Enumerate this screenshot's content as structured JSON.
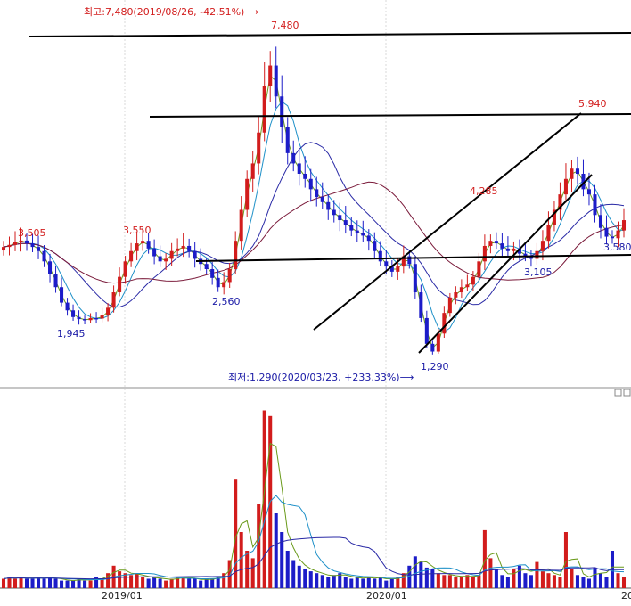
{
  "chart_data": {
    "type": "candlestick",
    "x_axis_labels": [
      "2019/01",
      "2020/01",
      "20"
    ],
    "high": {
      "text": "최고:7,480(2019/08/26, -42.51%)⟶",
      "value": 7480,
      "date": "2019/08/26",
      "change": "-42.51%"
    },
    "low": {
      "text": "최저:1,290(2020/03/23, +233.33%)⟶",
      "value": 1290,
      "date": "2020/03/23",
      "change": "+233.33%"
    },
    "price_labels": [
      {
        "text": "7,480",
        "value": 7480,
        "color": "#d21c1c"
      },
      {
        "text": "5,940",
        "value": 5940,
        "color": "#d21c1c"
      },
      {
        "text": "4,285",
        "value": 4285,
        "color": "#d21c1c"
      },
      {
        "text": "3,550",
        "value": 3550,
        "color": "#d21c1c"
      },
      {
        "text": "3,505",
        "value": 3505,
        "color": "#d21c1c"
      },
      {
        "text": "3,580",
        "value": 3580,
        "color": "#1a1aa6"
      },
      {
        "text": "3,105",
        "value": 3105,
        "color": "#1a1aa6"
      },
      {
        "text": "2,560",
        "value": 2560,
        "color": "#1a1aa6"
      },
      {
        "text": "1,945",
        "value": 1945,
        "color": "#1a1aa6"
      },
      {
        "text": "1,290",
        "value": 1290,
        "color": "#1a1aa6"
      }
    ],
    "weekly_close": [
      3380,
      3420,
      3480,
      3505,
      3450,
      3380,
      3300,
      3100,
      2850,
      2600,
      2300,
      2150,
      2020,
      1980,
      1960,
      2000,
      1990,
      2050,
      2200,
      2500,
      2800,
      3100,
      3300,
      3450,
      3500,
      3350,
      3200,
      3100,
      3150,
      3300,
      3350,
      3400,
      3300,
      3150,
      3050,
      2950,
      2780,
      2600,
      2700,
      2950,
      3500,
      4100,
      4700,
      5000,
      5600,
      6500,
      6900,
      6300,
      5700,
      5200,
      5000,
      4800,
      4700,
      4500,
      4350,
      4250,
      4100,
      4000,
      3900,
      3800,
      3700,
      3650,
      3600,
      3500,
      3300,
      3100,
      3000,
      2900,
      3000,
      3200,
      3050,
      2500,
      2000,
      1500,
      1350,
      1700,
      2100,
      2400,
      2500,
      2600,
      2650,
      2800,
      3100,
      3400,
      3500,
      3450,
      3350,
      3300,
      3350,
      3250,
      3200,
      3150,
      3300,
      3500,
      3800,
      4100,
      4400,
      4700,
      4900,
      4800,
      4500,
      4400,
      4000,
      3750,
      3580,
      3550,
      3700,
      3900
    ],
    "weekly_volume_relative": [
      0.05,
      0.06,
      0.05,
      0.06,
      0.05,
      0.05,
      0.06,
      0.05,
      0.06,
      0.05,
      0.04,
      0.04,
      0.04,
      0.05,
      0.04,
      0.04,
      0.06,
      0.05,
      0.08,
      0.12,
      0.09,
      0.08,
      0.07,
      0.08,
      0.06,
      0.05,
      0.06,
      0.05,
      0.04,
      0.05,
      0.06,
      0.06,
      0.05,
      0.05,
      0.04,
      0.05,
      0.05,
      0.06,
      0.08,
      0.15,
      0.58,
      0.3,
      0.2,
      0.16,
      0.45,
      0.95,
      0.92,
      0.4,
      0.3,
      0.2,
      0.15,
      0.12,
      0.1,
      0.09,
      0.08,
      0.07,
      0.06,
      0.07,
      0.08,
      0.06,
      0.05,
      0.06,
      0.05,
      0.06,
      0.05,
      0.06,
      0.04,
      0.05,
      0.06,
      0.08,
      0.12,
      0.17,
      0.14,
      0.11,
      0.1,
      0.08,
      0.07,
      0.07,
      0.06,
      0.06,
      0.07,
      0.06,
      0.07,
      0.31,
      0.16,
      0.1,
      0.07,
      0.06,
      0.1,
      0.12,
      0.08,
      0.07,
      0.14,
      0.09,
      0.08,
      0.07,
      0.06,
      0.3,
      0.1,
      0.07,
      0.06,
      0.05,
      0.11,
      0.08,
      0.06,
      0.2,
      0.08,
      0.06
    ],
    "trendlines": [
      "horizontal resistance near 7,480",
      "horizontal resistance near 5,940",
      "horizontal support near 3,105",
      "rising channel from 1,290 to 5,940"
    ],
    "moving_averages": [
      "5",
      "20",
      "60",
      "120"
    ],
    "grid": false
  }
}
